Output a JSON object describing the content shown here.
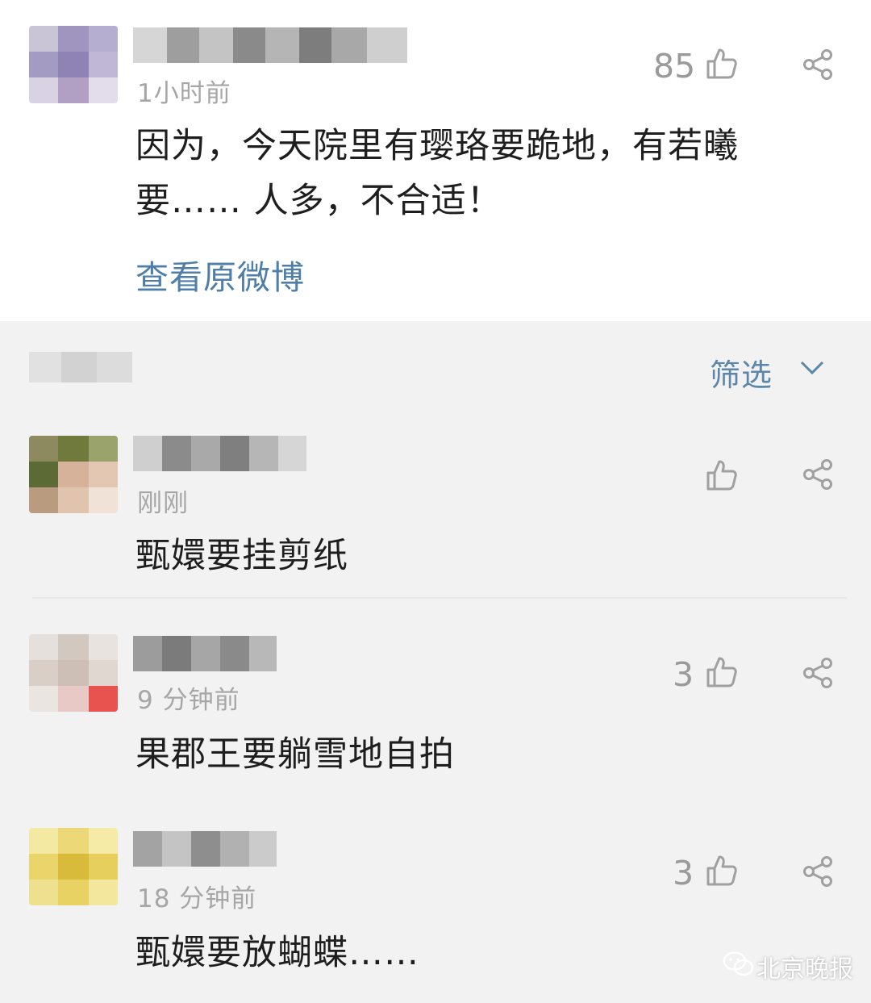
{
  "main_post": {
    "time": "1小时前",
    "likes": "85",
    "text_line1": "因为，今天院里有璎珞要跪地，有若曦",
    "text_line2": "要…… 人多，不合适！",
    "view_original": "查看原微博"
  },
  "filter": {
    "label": "筛选"
  },
  "comments": [
    {
      "time": "刚刚",
      "likes": "",
      "text": "甄嬛要挂剪纸"
    },
    {
      "time": "9 分钟前",
      "likes": "3",
      "text": "果郡王要躺雪地自拍"
    },
    {
      "time": "18 分钟前",
      "likes": "3",
      "text": "甄嬛要放蝴蝶……"
    }
  ],
  "watermark": {
    "text": "北京晚报"
  }
}
